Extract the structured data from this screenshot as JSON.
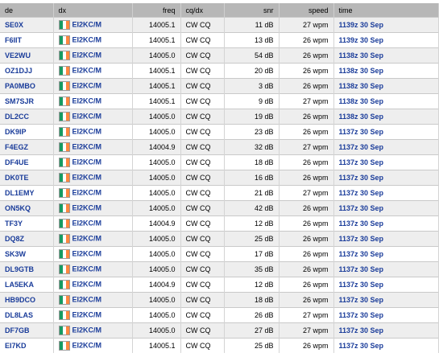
{
  "top_fragment": "",
  "headers": {
    "de": "de",
    "dx": "dx",
    "freq": "freq",
    "cqdx": "cq/dx",
    "snr": "snr",
    "speed": "speed",
    "time": "time"
  },
  "flag_colors": [
    "#169b62",
    "#ffffff",
    "#ff883e"
  ],
  "rows": [
    {
      "de": "SE0X",
      "dx": "EI2KC/M",
      "freq": "14005.1",
      "cq": "CW CQ",
      "snr": "11 dB",
      "speed": "27 wpm",
      "time": "1139z 30 Sep"
    },
    {
      "de": "F6IIT",
      "dx": "EI2KC/M",
      "freq": "14005.1",
      "cq": "CW CQ",
      "snr": "13 dB",
      "speed": "26 wpm",
      "time": "1139z 30 Sep"
    },
    {
      "de": "VE2WU",
      "dx": "EI2KC/M",
      "freq": "14005.0",
      "cq": "CW CQ",
      "snr": "54 dB",
      "speed": "26 wpm",
      "time": "1138z 30 Sep"
    },
    {
      "de": "OZ1DJJ",
      "dx": "EI2KC/M",
      "freq": "14005.1",
      "cq": "CW CQ",
      "snr": "20 dB",
      "speed": "26 wpm",
      "time": "1138z 30 Sep"
    },
    {
      "de": "PA0MBO",
      "dx": "EI2KC/M",
      "freq": "14005.1",
      "cq": "CW CQ",
      "snr": "3 dB",
      "speed": "26 wpm",
      "time": "1138z 30 Sep"
    },
    {
      "de": "SM7SJR",
      "dx": "EI2KC/M",
      "freq": "14005.1",
      "cq": "CW CQ",
      "snr": "9 dB",
      "speed": "27 wpm",
      "time": "1138z 30 Sep"
    },
    {
      "de": "DL2CC",
      "dx": "EI2KC/M",
      "freq": "14005.0",
      "cq": "CW CQ",
      "snr": "19 dB",
      "speed": "26 wpm",
      "time": "1138z 30 Sep"
    },
    {
      "de": "DK9IP",
      "dx": "EI2KC/M",
      "freq": "14005.0",
      "cq": "CW CQ",
      "snr": "23 dB",
      "speed": "26 wpm",
      "time": "1137z 30 Sep"
    },
    {
      "de": "F4EGZ",
      "dx": "EI2KC/M",
      "freq": "14004.9",
      "cq": "CW CQ",
      "snr": "32 dB",
      "speed": "27 wpm",
      "time": "1137z 30 Sep"
    },
    {
      "de": "DF4UE",
      "dx": "EI2KC/M",
      "freq": "14005.0",
      "cq": "CW CQ",
      "snr": "18 dB",
      "speed": "26 wpm",
      "time": "1137z 30 Sep"
    },
    {
      "de": "DK0TE",
      "dx": "EI2KC/M",
      "freq": "14005.0",
      "cq": "CW CQ",
      "snr": "16 dB",
      "speed": "26 wpm",
      "time": "1137z 30 Sep"
    },
    {
      "de": "DL1EMY",
      "dx": "EI2KC/M",
      "freq": "14005.0",
      "cq": "CW CQ",
      "snr": "21 dB",
      "speed": "27 wpm",
      "time": "1137z 30 Sep"
    },
    {
      "de": "ON5KQ",
      "dx": "EI2KC/M",
      "freq": "14005.0",
      "cq": "CW CQ",
      "snr": "42 dB",
      "speed": "26 wpm",
      "time": "1137z 30 Sep"
    },
    {
      "de": "TF3Y",
      "dx": "EI2KC/M",
      "freq": "14004.9",
      "cq": "CW CQ",
      "snr": "12 dB",
      "speed": "26 wpm",
      "time": "1137z 30 Sep"
    },
    {
      "de": "DQ8Z",
      "dx": "EI2KC/M",
      "freq": "14005.0",
      "cq": "CW CQ",
      "snr": "25 dB",
      "speed": "26 wpm",
      "time": "1137z 30 Sep"
    },
    {
      "de": "SK3W",
      "dx": "EI2KC/M",
      "freq": "14005.0",
      "cq": "CW CQ",
      "snr": "17 dB",
      "speed": "26 wpm",
      "time": "1137z 30 Sep"
    },
    {
      "de": "DL9GTB",
      "dx": "EI2KC/M",
      "freq": "14005.0",
      "cq": "CW CQ",
      "snr": "35 dB",
      "speed": "26 wpm",
      "time": "1137z 30 Sep"
    },
    {
      "de": "LA5EKA",
      "dx": "EI2KC/M",
      "freq": "14004.9",
      "cq": "CW CQ",
      "snr": "12 dB",
      "speed": "26 wpm",
      "time": "1137z 30 Sep"
    },
    {
      "de": "HB9DCO",
      "dx": "EI2KC/M",
      "freq": "14005.0",
      "cq": "CW CQ",
      "snr": "18 dB",
      "speed": "26 wpm",
      "time": "1137z 30 Sep"
    },
    {
      "de": "DL8LAS",
      "dx": "EI2KC/M",
      "freq": "14005.0",
      "cq": "CW CQ",
      "snr": "26 dB",
      "speed": "27 wpm",
      "time": "1137z 30 Sep"
    },
    {
      "de": "DF7GB",
      "dx": "EI2KC/M",
      "freq": "14005.0",
      "cq": "CW CQ",
      "snr": "27 dB",
      "speed": "27 wpm",
      "time": "1137z 30 Sep"
    },
    {
      "de": "EI7KD",
      "dx": "EI2KC/M",
      "freq": "14005.1",
      "cq": "CW CQ",
      "snr": "25 dB",
      "speed": "26 wpm",
      "time": "1137z 30 Sep"
    }
  ]
}
